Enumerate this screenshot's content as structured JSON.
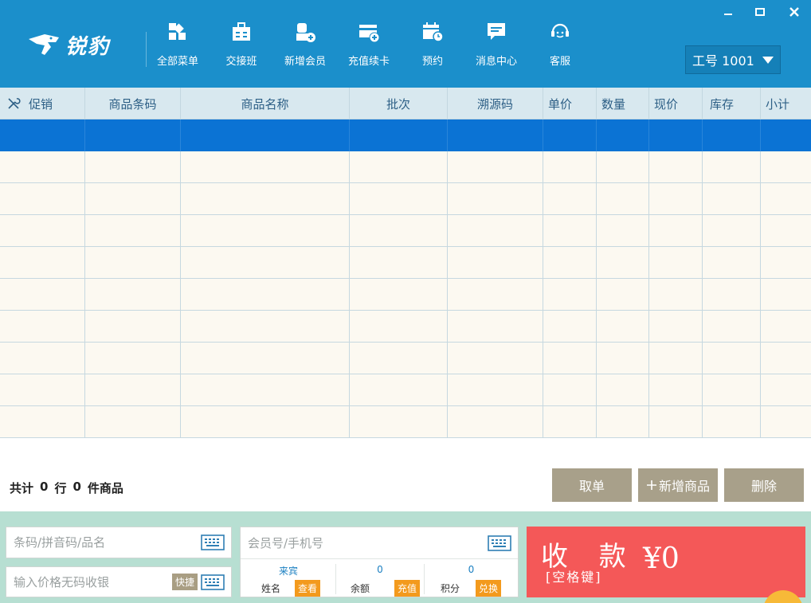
{
  "app": {
    "logo_text": "锐豹"
  },
  "nav": [
    {
      "label": "全部菜单",
      "icon": "grid-menu-icon"
    },
    {
      "label": "交接班",
      "icon": "briefcase-icon"
    },
    {
      "label": "新增会员",
      "icon": "add-member-icon"
    },
    {
      "label": "充值续卡",
      "icon": "card-add-icon"
    },
    {
      "label": "预约",
      "icon": "calendar-clock-icon"
    },
    {
      "label": "消息中心",
      "icon": "message-icon"
    },
    {
      "label": "客服",
      "icon": "headset-icon"
    }
  ],
  "window": {
    "minimize": "minimize-icon",
    "maximize": "maximize-icon",
    "close": "close-icon"
  },
  "staff": {
    "label": "工号 1001"
  },
  "table": {
    "columns": [
      "促销",
      "商品条码",
      "商品名称",
      "批次",
      "溯源码",
      "单价",
      "数量",
      "现价",
      "库存",
      "小计"
    ],
    "rows": [
      [],
      [],
      [],
      [],
      [],
      [],
      [],
      [],
      [],
      []
    ],
    "selected_row": 0
  },
  "summary": {
    "prefix": "共计",
    "rows": "0",
    "row_unit": "行",
    "items": "0",
    "item_unit": "件商品"
  },
  "actions": {
    "cancel": "取单",
    "add_product": "新增商品",
    "delete": "删除"
  },
  "inputs": {
    "barcode_placeholder": "条码/拼音码/品名",
    "price_placeholder": "输入价格无码收银",
    "quick": "快捷"
  },
  "member": {
    "placeholder": "会员号/手机号",
    "name_value": "来宾",
    "name_label": "姓名",
    "name_tag": "查看",
    "balance_value": "0",
    "balance_label": "余额",
    "balance_tag": "充值",
    "points_value": "0",
    "points_label": "积分",
    "points_tag": "兑换"
  },
  "checkout": {
    "label": "收 款",
    "hint": "[空格键]",
    "amount": "¥0"
  },
  "colors": {
    "header": "#1b8fcb",
    "selected_row": "#0b73d4",
    "checkout": "#f45858",
    "tag": "#f39a1d",
    "action": "#a8a08a"
  }
}
